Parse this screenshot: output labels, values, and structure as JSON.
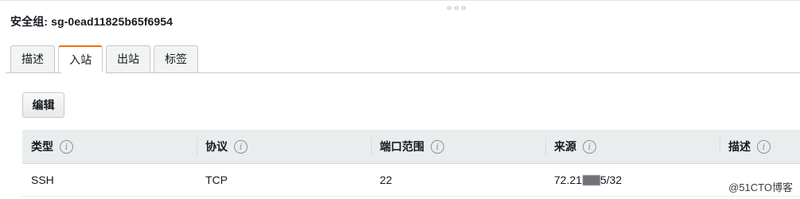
{
  "security_group": {
    "title_prefix": "安全组:",
    "id": "sg-0ead11825b65f6954"
  },
  "tabs": [
    {
      "label": "描述",
      "active": false
    },
    {
      "label": "入站",
      "active": true
    },
    {
      "label": "出站",
      "active": false
    },
    {
      "label": "标签",
      "active": false
    }
  ],
  "actions": {
    "edit_label": "编辑"
  },
  "table": {
    "columns": [
      "类型",
      "协议",
      "端口范围",
      "来源",
      "描述"
    ],
    "info_icon_glyph": "i",
    "rows": [
      {
        "type": "SSH",
        "protocol": "TCP",
        "port_range": "22",
        "source_start": "72.21.",
        "source_end": "5/32",
        "description": ""
      }
    ]
  },
  "watermark": "@51CTO博客",
  "colors": {
    "accent_tab": "#ec7211",
    "header_bg": "#eaeded",
    "border": "#c6c8cc"
  }
}
